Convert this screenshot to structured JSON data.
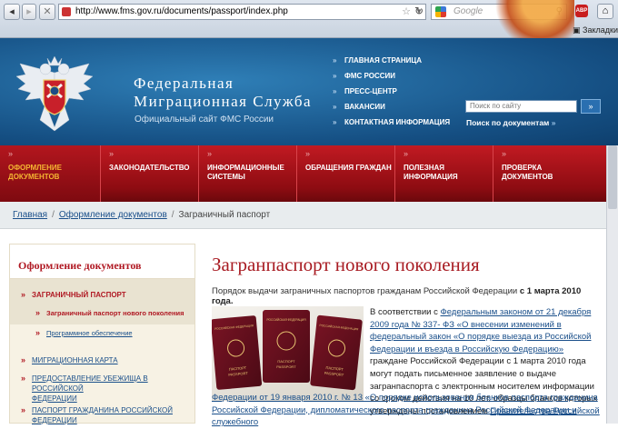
{
  "browser": {
    "url": "http://www.fms.gov.ru/documents/passport/index.php",
    "search_placeholder": "Google",
    "bookmarks_label": "Закладки",
    "abp_label": "ABP"
  },
  "header": {
    "org_line1": "Федеральная",
    "org_line2": "Миграционная Служба",
    "subtitle": "Официальный сайт ФМС России",
    "top_nav": [
      "ГЛАВНАЯ СТРАНИЦА",
      "ФМС РОССИИ",
      "ПРЕСС-ЦЕНТР",
      "ВАКАНСИИ",
      "КОНТАКТНАЯ ИНФОРМАЦИЯ"
    ],
    "search_placeholder": "Поиск по сайту",
    "search_go": "»",
    "doc_search": "Поиск по документам",
    "doc_search_arrow": "»"
  },
  "main_menu": [
    {
      "line1": "Оформление",
      "line2": "документов"
    },
    {
      "line1": "Законодательство",
      "line2": ""
    },
    {
      "line1": "Информационные",
      "line2": "системы"
    },
    {
      "line1": "Обращения граждан",
      "line2": ""
    },
    {
      "line1": "Полезная",
      "line2": "информация"
    },
    {
      "line1": "Проверка",
      "line2": "документов"
    }
  ],
  "breadcrumb": {
    "home": "Главная",
    "section": "Оформление документов",
    "current": "Заграничный паспорт"
  },
  "sidebar": {
    "title": "Оформление документов",
    "active_item": "ЗАГРАНИЧНЫЙ ПАСПОРТ",
    "sub_active": "Заграничный паспорт нового поколения",
    "sub_item": "Программное обеспечение",
    "item2": "МИГРАЦИОННАЯ КАРТА",
    "item3_l1": "ПРЕДОСТАВЛЕНИЕ УБЕЖИЩА В РОССИЙСКОЙ",
    "item3_l2": "ФЕДЕРАЦИИ",
    "item4_l1": "ПАСПОРТ ГРАЖДАНИНА РОССИЙСКОЙ",
    "item4_l2": "ФЕДЕРАЦИИ"
  },
  "content": {
    "title": "Загранпаспорт нового поколения",
    "lead_text": "Порядок выдачи заграничных паспортов гражданам Российской Федерации",
    "lead_bold": "с 1 марта 2010 года.",
    "intro": "В соответствии с",
    "link1": "Федеральным законом от 21 декабря 2009 года № 337- ФЗ «О внесении изменений в федеральный закон «О порядке выезда из Российской Федерации и въезда в Российскую Федерацию»",
    "after_link1": "граждане Российской Федерации с 1 марта 2010 года могут подать письменное заявление о выдаче загранпаспорта с электронным носителем информации со сроком действия на 10 лет, образцы бланков которых утверждены постановлением",
    "link2a": "Правительства Российской",
    "link2b": "Федерации от 19 января 2010 г. № 13 «О порядке использования бланков паспорта гражданина Российской Федерации, дипломатического паспорта гражданина Российской Федерации и служебного"
  },
  "passports": {
    "country": "РОССИЙСКАЯ ФЕДЕРАЦИЯ",
    "label1": "ПАСПОРТ",
    "label2": "PASSPORT"
  }
}
